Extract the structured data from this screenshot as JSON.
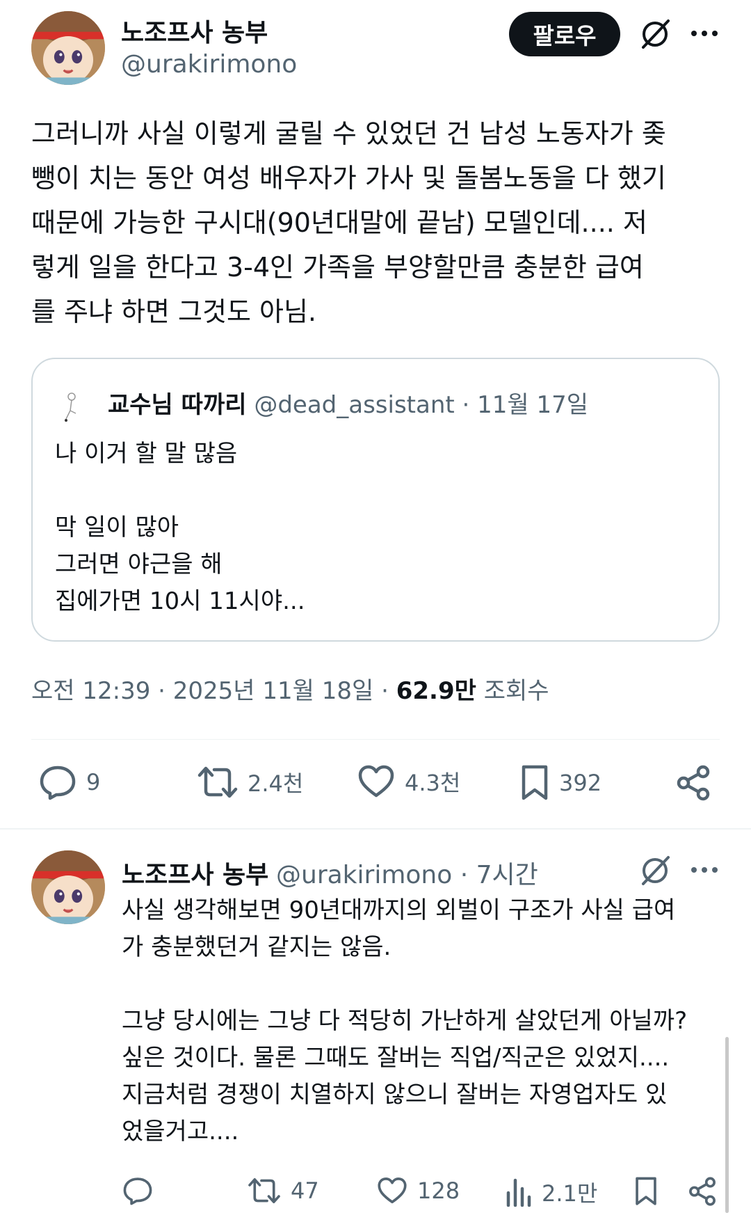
{
  "post": {
    "author_name": "노조프사 농부",
    "author_handle": "@urakirimono",
    "follow_label": "팔로우",
    "lines": [
      "그러니까 사실 이렇게 굴릴 수 있었던 건 남성 노동자가 좆",
      "뺑이 치는 동안 여성 배우자가 가사 및 돌봄노동을 다 했기",
      "때문에 가능한 구시대(90년대말에 끝남) 모델인데.... 저",
      "렇게 일을 한다고 3-4인 가족을 부양할만큼 충분한 급여",
      "를 주냐 하면 그것도 아님."
    ],
    "quote": {
      "name": "교수님 따까리",
      "handle": "@dead_assistant",
      "date": "· 11월 17일",
      "lines": [
        "나 이거 할 말 많음",
        "",
        "막 일이 많아",
        "그러면 야근을 해",
        "집에가면 10시 11시야..."
      ]
    },
    "time": "오전 12:39 · 2025년 11월 18일 · ",
    "views": "62.9만",
    "views_label": " 조회수",
    "actions": {
      "replies": "9",
      "reposts": "2.4천",
      "likes": "4.3천",
      "bookmarks": "392"
    }
  },
  "reply": {
    "author_name": "노조프사 농부",
    "author_handle": "@urakirimono",
    "time": "· 7시간",
    "lines": [
      "사실 생각해보면 90년대까지의 외벌이 구조가 사실 급여",
      "가 충분했던거 같지는 않음.",
      "",
      "그냥 당시에는 그냥 다 적당히 가난하게 살았던게 아닐까?",
      "싶은 것이다. 물론 그때도 잘버는 직업/직군은 있었지....",
      "지금처럼 경쟁이 치열하지 않으니 잘버는 자영업자도 있",
      "었을거고...."
    ],
    "actions": {
      "replies": "",
      "reposts": "47",
      "likes": "128",
      "views": "2.1만"
    }
  },
  "icons": [
    "grok-icon",
    "more-icon",
    "reply-icon",
    "repost-icon",
    "like-icon",
    "bookmark-icon",
    "share-icon",
    "views-icon"
  ]
}
